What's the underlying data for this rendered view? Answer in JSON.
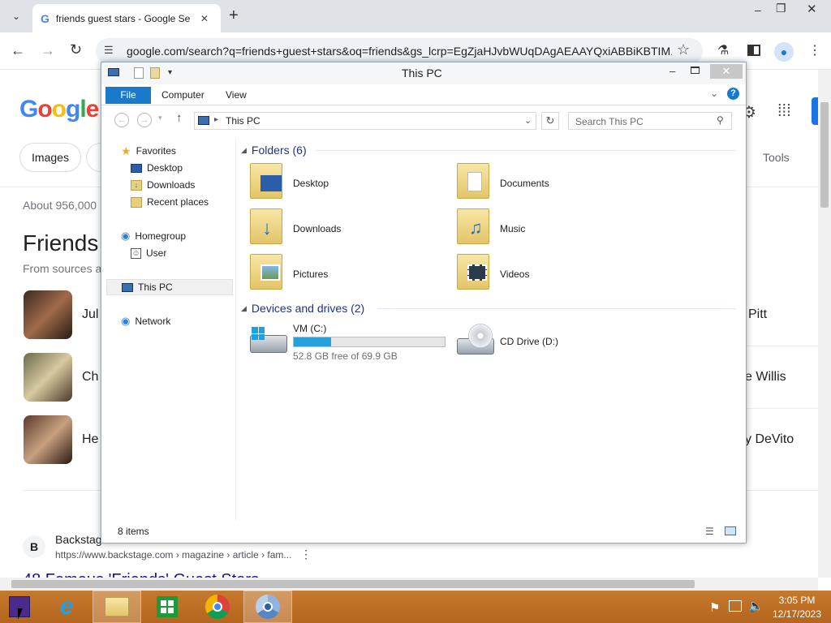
{
  "browser": {
    "tab_title": "friends guest stars - Google Se",
    "url": "google.com/search?q=friends+guest+stars&oq=friends&gs_lcrp=EgZjaHJvbWUqDAgAEAAYQxiABBiKBTIM...",
    "new_tab": "+",
    "close_tab": "✕"
  },
  "google": {
    "chip_images": "Images",
    "tools": "Tools",
    "about_results": "About 956,000",
    "heading": "Friends",
    "sources_text": "From sources a",
    "people_left": [
      "Jul",
      "Ch",
      "He"
    ],
    "people_right": [
      "Pitt",
      "e Willis",
      "y DeVito"
    ],
    "result_site": "Backstage",
    "result_url": "https://www.backstage.com › magazine › article › fam...",
    "result_title": "48 Famous 'Friends' Guest Stars"
  },
  "explorer": {
    "title": "This PC",
    "ribbon_tabs": [
      "File",
      "Computer",
      "View"
    ],
    "address": "This PC",
    "search_placeholder": "Search This PC",
    "nav": {
      "favorites": "Favorites",
      "desktop": "Desktop",
      "downloads": "Downloads",
      "recent": "Recent places",
      "homegroup": "Homegroup",
      "user": "User",
      "this_pc": "This PC",
      "network": "Network"
    },
    "folders_header": "Folders (6)",
    "folders": [
      "Desktop",
      "Documents",
      "Downloads",
      "Music",
      "Pictures",
      "Videos"
    ],
    "drives_header": "Devices and drives (2)",
    "drive_c_name": "VM (C:)",
    "drive_c_free": "52.8 GB free of 69.9 GB",
    "drive_c_used_fraction": 0.245,
    "drive_d_name": "CD Drive (D:)",
    "status_items": "8 items"
  },
  "taskbar": {
    "time": "3:05 PM",
    "date": "12/17/2023"
  },
  "colors": {
    "accent_blue": "#1979ca",
    "taskbar": "#c0722a",
    "drive_bar": "#26a0da"
  }
}
